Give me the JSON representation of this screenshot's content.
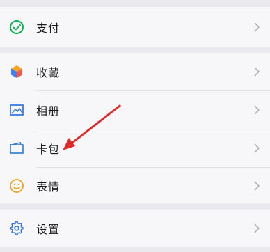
{
  "colors": {
    "pay_green": "#10b351",
    "favorites_blue": "#3f7df0",
    "favorites_orange": "#f5a623",
    "favorites_red": "#f05a4f",
    "album_blue": "#3b79e6",
    "cards_blue": "#2f7bd8",
    "stickers_yellow": "#f3a11e",
    "settings_blue": "#3b79e6",
    "annotation_red": "#e02a2a"
  },
  "menu": {
    "pay": {
      "label": "支付",
      "icon": "pay-icon"
    },
    "favorites": {
      "label": "收藏",
      "icon": "favorites-cube-icon"
    },
    "album": {
      "label": "相册",
      "icon": "album-image-icon"
    },
    "cards": {
      "label": "卡包",
      "icon": "card-wallet-icon"
    },
    "stickers": {
      "label": "表情",
      "icon": "smiley-icon"
    },
    "settings": {
      "label": "设置",
      "icon": "gear-icon"
    }
  }
}
